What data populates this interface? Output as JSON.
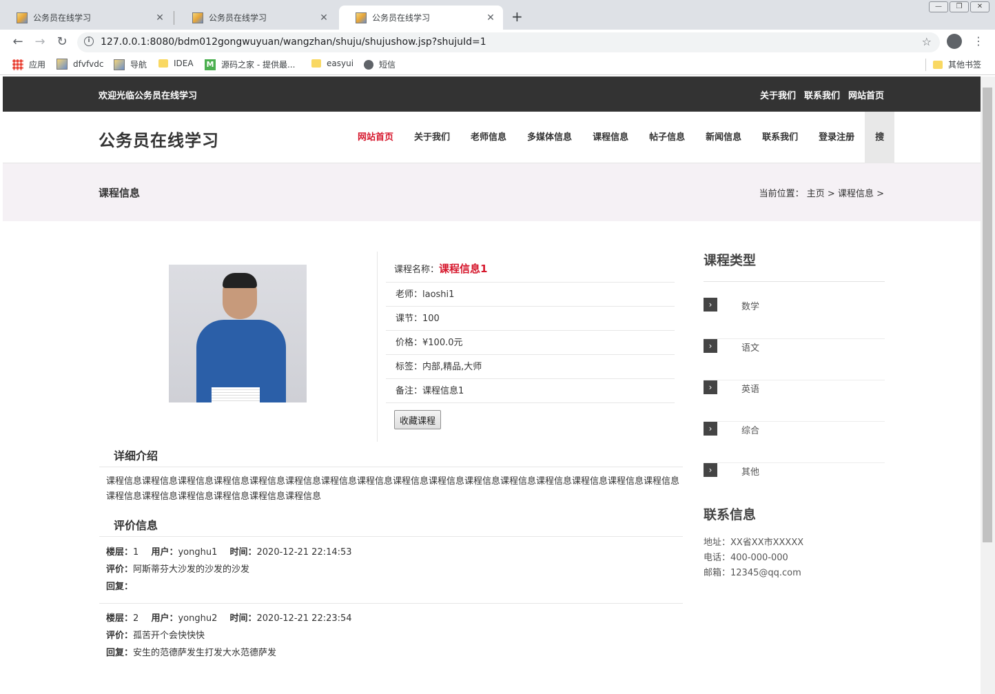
{
  "browser": {
    "tabs": [
      {
        "title": "公务员在线学习"
      },
      {
        "title": "公务员在线学习"
      },
      {
        "title": "公务员在线学习"
      }
    ],
    "tab_close": "✕",
    "new_tab": "+",
    "win": {
      "minimize": "—",
      "restore": "❐",
      "close": "✕"
    },
    "url": "127.0.0.1:8080/bdm012gongwuyuan/wangzhan/shuju/shujushow.jsp?shujuId=1",
    "bookmarks": [
      {
        "label": "应用",
        "icon": "apps-icon"
      },
      {
        "label": "dfvfvdc",
        "icon": "picture-icon"
      },
      {
        "label": "导航",
        "icon": "picture-icon"
      },
      {
        "label": "IDEA",
        "icon": "folder-icon"
      },
      {
        "label": "源码之家 - 提供最...",
        "icon": "m-icon"
      },
      {
        "label": "easyui",
        "icon": "folder-icon"
      },
      {
        "label": "短信",
        "icon": "globe-icon"
      }
    ],
    "other_bookmarks": "其他书签"
  },
  "site": {
    "welcome": "欢迎光临公务员在线学习",
    "top_links": [
      "关于我们",
      "联系我们",
      "网站首页"
    ],
    "logo": "公务员在线学习",
    "nav": [
      "网站首页",
      "关于我们",
      "老师信息",
      "多媒体信息",
      "课程信息",
      "帖子信息",
      "新闻信息",
      "联系我们",
      "登录注册"
    ],
    "nav_search": "搜",
    "page_title": "课程信息",
    "breadcrumb": "当前位置： 主页 > 课程信息 >"
  },
  "course": {
    "name_label": "课程名称：",
    "name": "课程信息1",
    "rows": [
      "老师：laoshi1",
      "课节：100",
      "价格：¥100.0元",
      "标签：内部,精品,大师",
      "备注：课程信息1"
    ],
    "fav_button": "收藏课程",
    "detail_title": "详细介绍",
    "detail_text": "课程信息课程信息课程信息课程信息课程信息课程信息课程信息课程信息课程信息课程信息课程信息课程信息课程信息课程信息课程信息课程信息课程信息课程信息课程信息课程信息课程信息课程信息",
    "review_title": "评价信息"
  },
  "comments": [
    {
      "floor_label": "楼层：",
      "floor": "1",
      "user_label": "用户：",
      "user": "yonghu1",
      "time_label": "时间：",
      "time": "2020-12-21 22:14:53",
      "review_label": "评价：",
      "review": "阿斯蒂芬大沙发的沙发的沙发",
      "reply_label": "回复：",
      "reply": ""
    },
    {
      "floor_label": "楼层：",
      "floor": "2",
      "user_label": "用户：",
      "user": "yonghu2",
      "time_label": "时间：",
      "time": "2020-12-21 22:23:54",
      "review_label": "评价：",
      "review": "孤苦开个会快快快",
      "reply_label": "回复：",
      "reply": "安生的范德萨发生打发大水范德萨发"
    }
  ],
  "sidebar": {
    "types_title": "课程类型",
    "types": [
      "数学",
      "语文",
      "英语",
      "综合",
      "其他"
    ],
    "contact_title": "联系信息",
    "address": "地址：XX省XX市XXXXX",
    "phone": "电话：400-000-000",
    "email": "邮箱：12345@qq.com"
  },
  "colors": {
    "accent": "#d6172c",
    "topbar": "#333333",
    "crumbbar": "#f5f1f5"
  }
}
